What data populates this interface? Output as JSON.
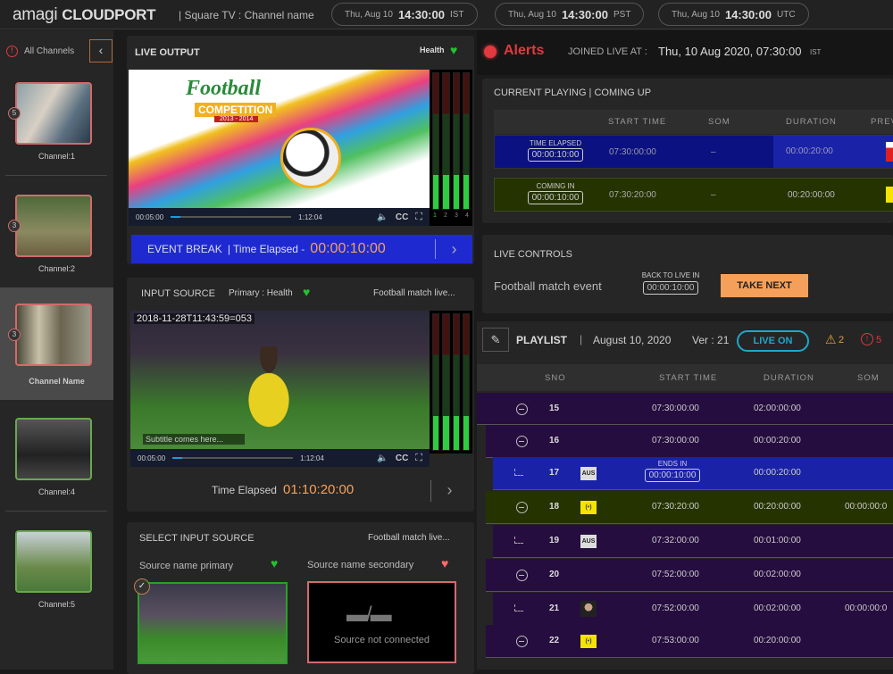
{
  "header": {
    "logo_light": "amagi",
    "logo_bold": "CLOUDPORT",
    "channel": "| Square TV :  Channel name",
    "clocks": [
      {
        "date": "Thu, Aug 10",
        "time": "14:30:00",
        "zone": "IST"
      },
      {
        "date": "Thu, Aug 10",
        "time": "14:30:00",
        "zone": "PST"
      },
      {
        "date": "Thu, Aug 10",
        "time": "14:30:00",
        "zone": "UTC"
      }
    ]
  },
  "sidebar": {
    "all_channels": "All Channels",
    "channels": [
      {
        "label": "Channel:1",
        "badge": "5"
      },
      {
        "label": "Channel:2",
        "badge": "3"
      },
      {
        "label": "Channel Name",
        "badge": "3",
        "selected": true
      },
      {
        "label": "Channel:4",
        "badge": ""
      },
      {
        "label": "Channel:5",
        "badge": ""
      }
    ]
  },
  "live_output": {
    "title": "LIVE OUTPUT",
    "health": "Health",
    "overlay_title": "Football",
    "overlay_sub": "COMPETITION",
    "overlay_years": "2013 - 2014",
    "current": "00:05:00",
    "total": "1:12:04",
    "progress_percent": 8,
    "cc": "CC",
    "meters": [
      "1",
      "2",
      "3",
      "4"
    ],
    "event": "EVENT BREAK",
    "elapsed_label": "| Time Elapsed -",
    "elapsed": "00:00:10:00"
  },
  "input_source": {
    "title": "INPUT SOURCE",
    "primary": "Primary :  Health",
    "name": "Football match live...",
    "timestamp": "2018-11-28T11:43:59=053",
    "subtitle": "Subtitle comes here...",
    "current": "00:05:00",
    "total": "1:12:04",
    "progress_percent": 8,
    "cc": "CC",
    "elapsed_label": "Time Elapsed",
    "elapsed": "01:10:20:00"
  },
  "select_source": {
    "title": "SELECT INPUT SOURCE",
    "name": "Football match live...",
    "primary": "Source name primary",
    "secondary": "Source name secondary",
    "not_connected": "Source not connected"
  },
  "alerts": {
    "label": "Alerts",
    "joined_label": "JOINED LIVE AT :",
    "joined_value": "Thu, 10 Aug 2020, 07:30:00",
    "joined_zone": "IST"
  },
  "current": {
    "title": "CURRENT PLAYING |  COMING UP",
    "columns": [
      "START TIME",
      "SOM",
      "DURATION",
      "PREV"
    ],
    "rows": [
      {
        "label": "TIME ELAPSED",
        "timer": "00:00:10:00",
        "start": "07:30:00:00",
        "som": "–",
        "duration": "00:00:20:00"
      },
      {
        "label": "COMING IN",
        "timer": "00:00:10:00",
        "start": "07:30:20:00",
        "som": "–",
        "duration": "00:20:00:00"
      }
    ]
  },
  "live_controls": {
    "title": "LIVE CONTROLS",
    "event": "Football match event",
    "back_label": "BACK TO LIVE IN",
    "back_timer": "00:00:10:00",
    "take_next": "TAKE NEXT"
  },
  "playlist": {
    "title": "PLAYLIST",
    "date": "August 10, 2020",
    "version": "Ver : 21",
    "live": "LIVE ON",
    "warnings": "2",
    "errors": "5",
    "columns": [
      "SNO",
      "START TIME",
      "DURATION",
      "SOM"
    ],
    "rows": [
      {
        "sno": "15",
        "type": "group",
        "start": "07:30:00:00",
        "duration": "02:00:00:00",
        "som": "",
        "thumb": ""
      },
      {
        "sno": "16",
        "type": "group",
        "start": "07:30:00:00",
        "duration": "00:00:20:00",
        "som": "",
        "thumb": ""
      },
      {
        "sno": "17",
        "type": "item",
        "state": "playing",
        "ends_label": "ENDS IN",
        "ends": "00:00:10:00",
        "duration": "00:00:20:00",
        "som": "",
        "thumb": "AUS"
      },
      {
        "sno": "18",
        "type": "group",
        "state": "next",
        "start": "07:30:20:00",
        "duration": "00:20:00:00",
        "som": "00:00:00:0",
        "thumb": "(•)"
      },
      {
        "sno": "19",
        "type": "item",
        "start": "07:32:00:00",
        "duration": "00:01:00:00",
        "som": "",
        "thumb": "AUS"
      },
      {
        "sno": "20",
        "type": "group",
        "start": "07:52:00:00",
        "duration": "00:02:00:00",
        "som": "",
        "thumb": ""
      },
      {
        "sno": "21",
        "type": "item",
        "start": "07:52:00:00",
        "duration": "00:02:00:00",
        "som": "00:00:00:0",
        "thumb": "person"
      },
      {
        "sno": "22",
        "type": "group",
        "start": "07:53:00:00",
        "duration": "00:20:00:00",
        "som": "",
        "thumb": "(•)"
      }
    ]
  },
  "colors": {
    "accent_orange": "#f5a05a",
    "playing_blue": "#0b1180",
    "next_green": "#253300",
    "playlist_purple": "#260d3f",
    "health_green": "#22c22e",
    "alert_red": "#e0393e",
    "live_cyan": "#1ea7c9"
  }
}
